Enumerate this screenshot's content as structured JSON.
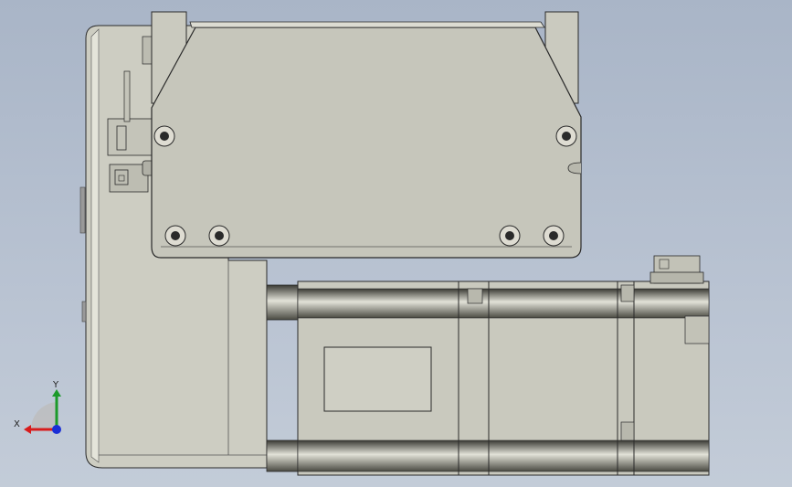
{
  "viewport": {
    "background_top": "#a9b5c7",
    "background_bottom": "#c3ccd8",
    "part_fill": "#c8c8bd",
    "part_fill_light": "#d6d6cc",
    "edge_color": "#2a2a2a"
  },
  "triad": {
    "x_label": "X",
    "y_label": "Y",
    "x_color": "#d81c1c",
    "y_color": "#1c9a2a",
    "z_color": "#1a2fd6"
  }
}
